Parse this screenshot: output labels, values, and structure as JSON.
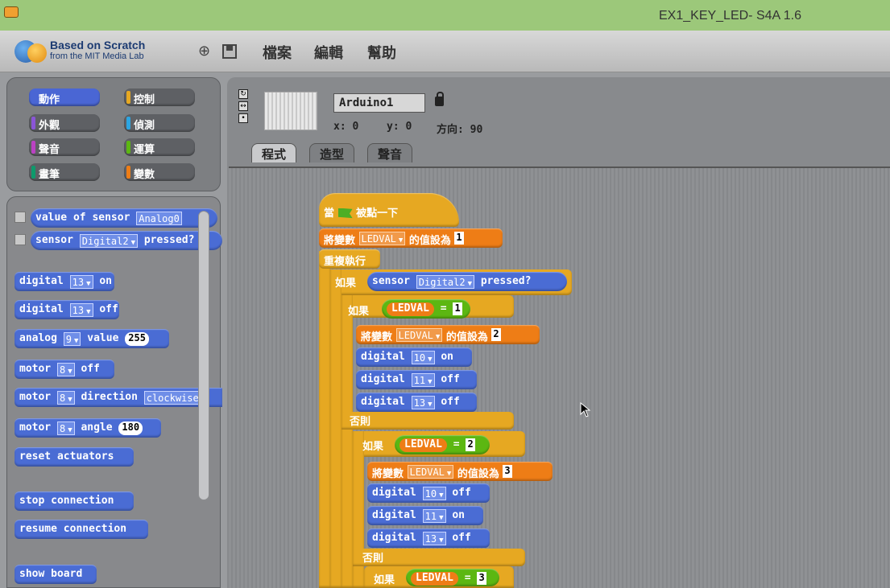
{
  "window": {
    "title": "EX1_KEY_LED- S4A 1.6"
  },
  "logo": {
    "line1": "Based on Scratch",
    "line2": "from the MIT Media Lab"
  },
  "menu": {
    "file": "檔案",
    "edit": "編輯",
    "help": "幫助"
  },
  "categories": [
    {
      "label": "動作",
      "color": "#4a66d4"
    },
    {
      "label": "控制",
      "color": "#e6a822"
    },
    {
      "label": "外觀",
      "color": "#8a55d7"
    },
    {
      "label": "偵測",
      "color": "#2ca5e2"
    },
    {
      "label": "聲音",
      "color": "#bb42c3"
    },
    {
      "label": "運算",
      "color": "#5cb712"
    },
    {
      "label": "畫筆",
      "color": "#0e9a6c"
    },
    {
      "label": "變數",
      "color": "#ee7d16"
    }
  ],
  "palette": {
    "value_of_sensor": {
      "text": "value of sensor",
      "dropdown": "Analog0"
    },
    "sensor_pressed": {
      "prefix": "sensor",
      "dropdown": "Digital2",
      "suffix": "pressed?"
    },
    "digital_on": {
      "prefix": "digital",
      "pin": "13",
      "suffix": "on"
    },
    "digital_off": {
      "prefix": "digital",
      "pin": "13",
      "suffix": "off"
    },
    "analog_value": {
      "prefix": "analog",
      "pin": "9",
      "mid": "value",
      "value": "255"
    },
    "motor_off": {
      "prefix": "motor",
      "pin": "8",
      "suffix": "off"
    },
    "motor_direction": {
      "prefix": "motor",
      "pin": "8",
      "mid": "direction",
      "dropdown": "clockwise"
    },
    "motor_angle": {
      "prefix": "motor",
      "pin": "8",
      "mid": "angle",
      "value": "180"
    },
    "reset": "reset actuators",
    "stop": "stop connection",
    "resume": "resume connection",
    "show_board": "show board"
  },
  "sprite": {
    "name": "Arduino1",
    "x_label": "x: 0",
    "y_label": "y: 0",
    "dir_label": "方向: 90"
  },
  "tabs": {
    "scripts": "程式",
    "costumes": "造型",
    "sounds": "聲音"
  },
  "script": {
    "hat_when": "當",
    "hat_clicked": "被點一下",
    "set_prefix": "將變數",
    "set_var": "LEDVAL",
    "set_mid": "的值設為",
    "set_val_1": "1",
    "set_val_2": "2",
    "set_val_3": "3",
    "forever": "重複執行",
    "if": "如果",
    "else": "否則",
    "sensor": "sensor",
    "sensor_dd": "Digital2",
    "pressed": "pressed?",
    "ledval": "LEDVAL",
    "eq": "=",
    "cmp1": "1",
    "cmp2": "2",
    "cmp3": "3",
    "digital": "digital",
    "pin10": "10",
    "pin11": "11",
    "pin13": "13",
    "on": "on",
    "off": "off"
  }
}
